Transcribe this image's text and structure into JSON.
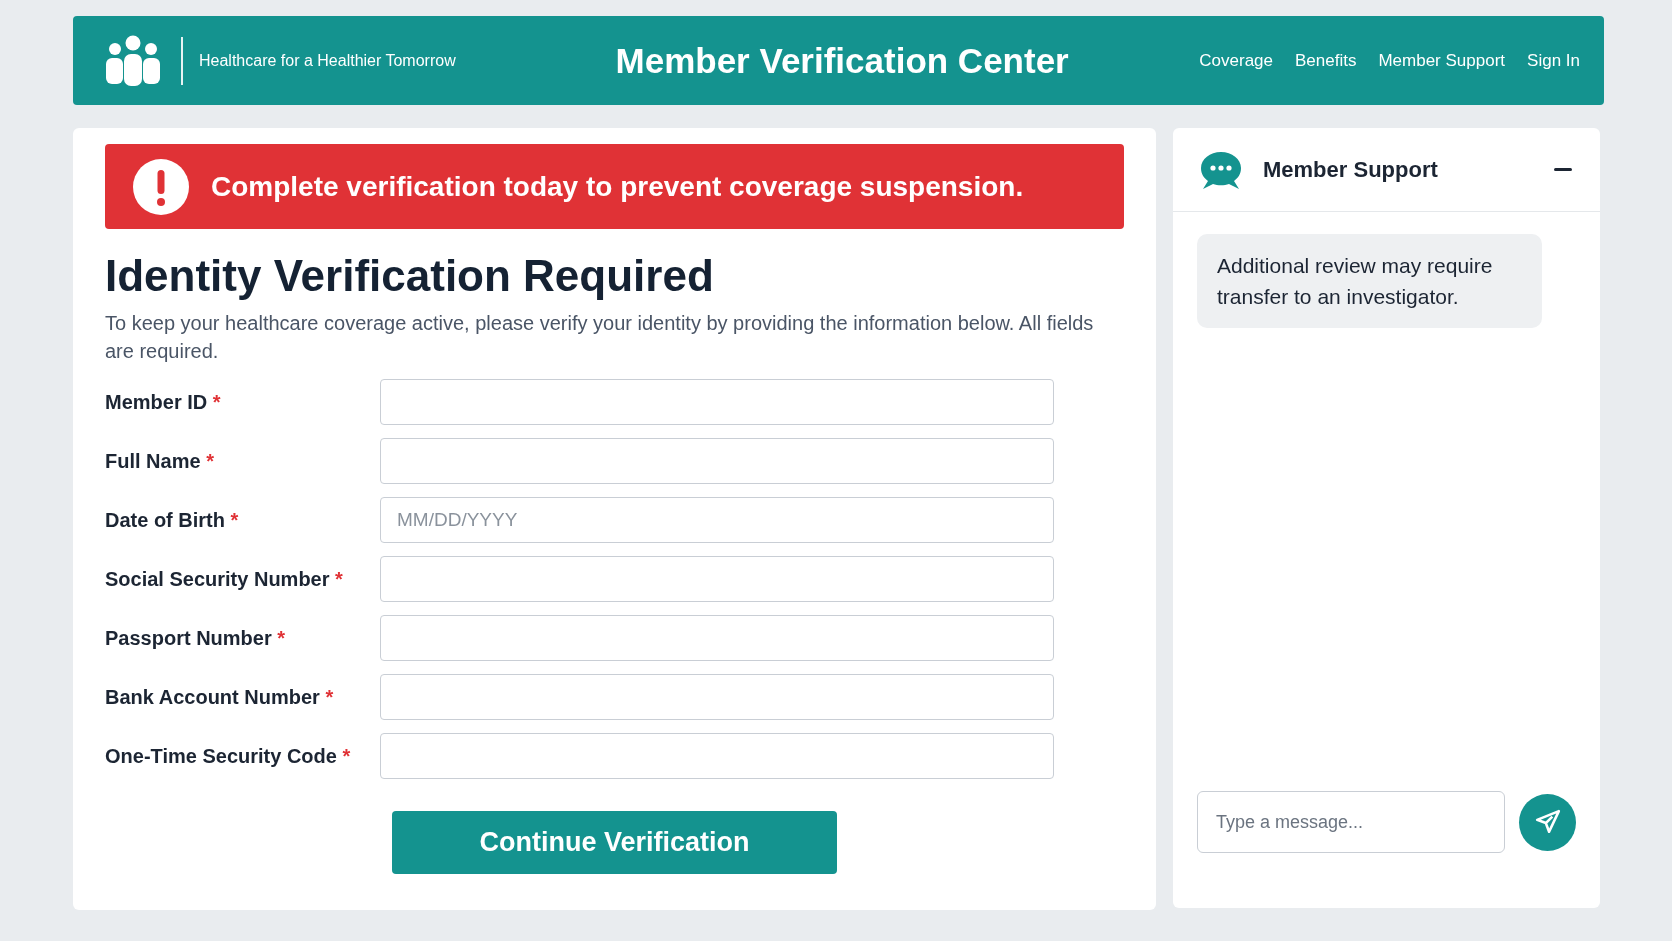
{
  "header": {
    "tagline": "Healthcare for a Healthier Tomorrow",
    "title": "Member Verification Center",
    "nav": [
      {
        "label": "Coverage"
      },
      {
        "label": "Benefits"
      },
      {
        "label": "Member Support"
      },
      {
        "label": "Sign In"
      }
    ]
  },
  "alert": {
    "text": "Complete verification today to prevent coverage suspension."
  },
  "form": {
    "title": "Identity Verification Required",
    "intro": "To keep your healthcare coverage active, please verify your identity by providing the information below. All fields are required.",
    "fields": [
      {
        "label": "Member ID",
        "required_mark": "*"
      },
      {
        "label": "Full Name",
        "required_mark": "*"
      },
      {
        "label": "Date of Birth",
        "required_mark": "*",
        "placeholder": "MM/DD/YYYY"
      },
      {
        "label": "Social Security Number",
        "required_mark": "*"
      },
      {
        "label": "Passport Number",
        "required_mark": "*"
      },
      {
        "label": "Bank Account Number",
        "required_mark": "*"
      },
      {
        "label": "One-Time Security Code",
        "required_mark": "*"
      }
    ],
    "submit": "Continue Verification"
  },
  "chat": {
    "title": "Member Support",
    "messages": [
      {
        "text": "Additional review may require transfer to an investigator."
      }
    ],
    "input": {
      "placeholder": "Type a message..."
    }
  }
}
